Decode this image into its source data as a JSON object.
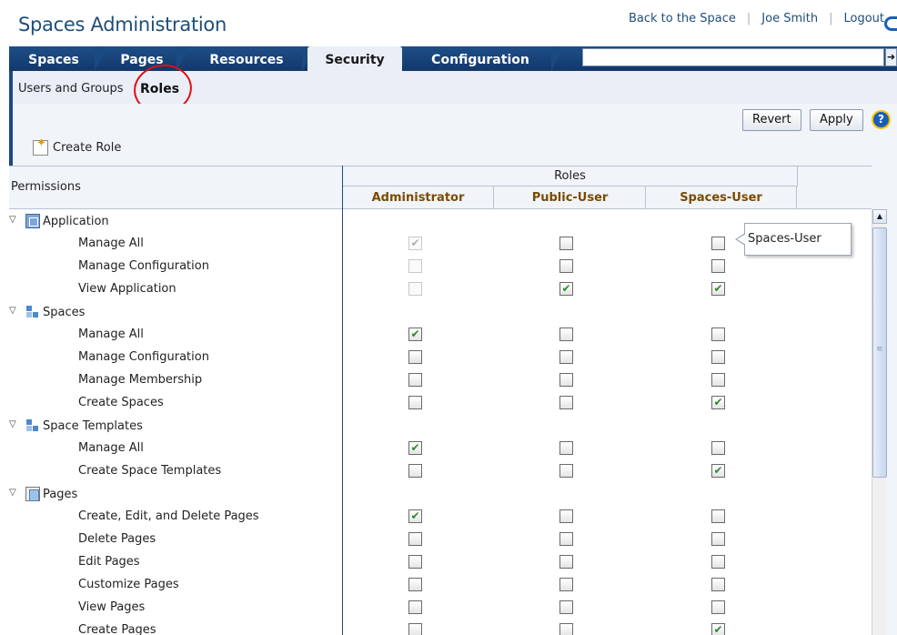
{
  "header": {
    "app_title": "Spaces Administration",
    "links": {
      "back": "Back to the Space",
      "user": "Joe Smith",
      "logout": "Logout"
    }
  },
  "tabs": [
    {
      "label": "Spaces"
    },
    {
      "label": "Pages"
    },
    {
      "label": "Resources"
    },
    {
      "label": "Security",
      "active": true
    },
    {
      "label": "Configuration"
    }
  ],
  "subtabs": {
    "users": "Users and Groups",
    "roles": "Roles"
  },
  "toolbar": {
    "revert": "Revert",
    "apply": "Apply",
    "help": "?",
    "create_role": "Create Role"
  },
  "table": {
    "permissions_header": "Permissions",
    "roles_header": "Roles",
    "roles": [
      "Administrator",
      "Public-User",
      "Spaces-User"
    ],
    "groups": [
      {
        "name": "Application",
        "icon": "application-icon",
        "rows": [
          {
            "label": "Manage All",
            "values": [
              true,
              false,
              false
            ],
            "disabled": [
              true,
              false,
              false
            ]
          },
          {
            "label": "Manage Configuration",
            "values": [
              false,
              false,
              false
            ],
            "disabled": [
              true,
              false,
              false
            ]
          },
          {
            "label": "View Application",
            "values": [
              false,
              true,
              true
            ],
            "disabled": [
              true,
              false,
              false
            ]
          }
        ]
      },
      {
        "name": "Spaces",
        "icon": "spaces-icon",
        "rows": [
          {
            "label": "Manage All",
            "values": [
              true,
              false,
              false
            ]
          },
          {
            "label": "Manage Configuration",
            "values": [
              false,
              false,
              false
            ]
          },
          {
            "label": "Manage Membership",
            "values": [
              false,
              false,
              false
            ]
          },
          {
            "label": "Create Spaces",
            "values": [
              false,
              false,
              true
            ]
          }
        ]
      },
      {
        "name": "Space Templates",
        "icon": "space-templates-icon",
        "rows": [
          {
            "label": "Manage All",
            "values": [
              true,
              false,
              false
            ]
          },
          {
            "label": "Create Space Templates",
            "values": [
              false,
              false,
              true
            ]
          }
        ]
      },
      {
        "name": "Pages",
        "icon": "pages-icon",
        "rows": [
          {
            "label": "Create, Edit, and Delete Pages",
            "values": [
              true,
              false,
              false
            ]
          },
          {
            "label": "Delete Pages",
            "values": [
              false,
              false,
              false
            ]
          },
          {
            "label": "Edit Pages",
            "values": [
              false,
              false,
              false
            ]
          },
          {
            "label": "Customize Pages",
            "values": [
              false,
              false,
              false
            ]
          },
          {
            "label": "View Pages",
            "values": [
              false,
              false,
              false
            ]
          },
          {
            "label": "Create Pages",
            "values": [
              false,
              false,
              true
            ]
          }
        ]
      }
    ]
  },
  "tooltip": {
    "text": "Spaces-User"
  }
}
